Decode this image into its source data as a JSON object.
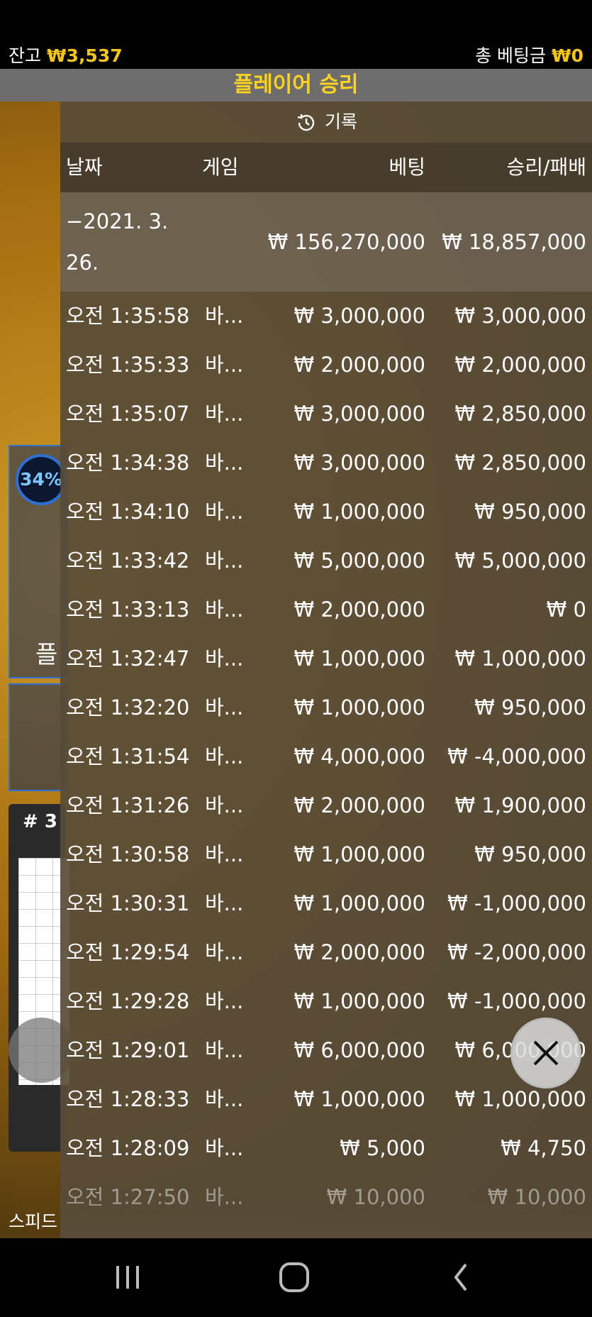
{
  "topbar": {
    "balance_label": "잔고",
    "balance_value": "₩3,537",
    "total_bet_label": "총 베팅금",
    "total_bet_value": "₩0"
  },
  "banner": {
    "text": "플레이어 승리"
  },
  "game_bg": {
    "wheel_percent": "34%",
    "peek_text": "플",
    "roadmap_hash": "# 3",
    "speed_text": "스피드"
  },
  "history": {
    "title": "기록",
    "columns": {
      "date": "날짜",
      "game": "게임",
      "bet": "베팅",
      "win_loss": "승리/패배"
    },
    "summary": {
      "date_line1": "−2021. 3.",
      "date_line2": "26.",
      "bet": "₩ 156,270,000",
      "win_loss": "₩ 18,857,000"
    },
    "rows": [
      {
        "time": "오전 1:35:58",
        "game": "바...",
        "bet": "₩ 3,000,000",
        "win_loss": "₩ 3,000,000"
      },
      {
        "time": "오전 1:35:33",
        "game": "바...",
        "bet": "₩ 2,000,000",
        "win_loss": "₩ 2,000,000"
      },
      {
        "time": "오전 1:35:07",
        "game": "바...",
        "bet": "₩ 3,000,000",
        "win_loss": "₩ 2,850,000"
      },
      {
        "time": "오전 1:34:38",
        "game": "바...",
        "bet": "₩ 3,000,000",
        "win_loss": "₩ 2,850,000"
      },
      {
        "time": "오전 1:34:10",
        "game": "바...",
        "bet": "₩ 1,000,000",
        "win_loss": "₩ 950,000"
      },
      {
        "time": "오전 1:33:42",
        "game": "바...",
        "bet": "₩ 5,000,000",
        "win_loss": "₩ 5,000,000"
      },
      {
        "time": "오전 1:33:13",
        "game": "바...",
        "bet": "₩ 2,000,000",
        "win_loss": "₩ 0"
      },
      {
        "time": "오전 1:32:47",
        "game": "바...",
        "bet": "₩ 1,000,000",
        "win_loss": "₩ 1,000,000"
      },
      {
        "time": "오전 1:32:20",
        "game": "바...",
        "bet": "₩ 1,000,000",
        "win_loss": "₩ 950,000"
      },
      {
        "time": "오전 1:31:54",
        "game": "바...",
        "bet": "₩ 4,000,000",
        "win_loss": "₩ -4,000,000"
      },
      {
        "time": "오전 1:31:26",
        "game": "바...",
        "bet": "₩ 2,000,000",
        "win_loss": "₩ 1,900,000"
      },
      {
        "time": "오전 1:30:58",
        "game": "바...",
        "bet": "₩ 1,000,000",
        "win_loss": "₩ 950,000"
      },
      {
        "time": "오전 1:30:31",
        "game": "바...",
        "bet": "₩ 1,000,000",
        "win_loss": "₩ -1,000,000"
      },
      {
        "time": "오전 1:29:54",
        "game": "바...",
        "bet": "₩ 2,000,000",
        "win_loss": "₩ -2,000,000"
      },
      {
        "time": "오전 1:29:28",
        "game": "바...",
        "bet": "₩ 1,000,000",
        "win_loss": "₩ -1,000,000"
      },
      {
        "time": "오전 1:29:01",
        "game": "바...",
        "bet": "₩ 6,000,000",
        "win_loss": "₩ 6,000,000"
      },
      {
        "time": "오전 1:28:33",
        "game": "바...",
        "bet": "₩ 1,000,000",
        "win_loss": "₩ 1,000,000"
      },
      {
        "time": "오전 1:28:09",
        "game": "바...",
        "bet": "₩ 5,000",
        "win_loss": "₩ 4,750"
      },
      {
        "time": "오전 1:27:50",
        "game": "바...",
        "bet": "₩ 10,000",
        "win_loss": "₩ 10,000"
      }
    ]
  },
  "icons": {
    "history": "history-clock-icon",
    "close": "close-icon",
    "nav_recents": "recents-icon",
    "nav_home": "home-icon",
    "nav_back": "back-icon"
  }
}
